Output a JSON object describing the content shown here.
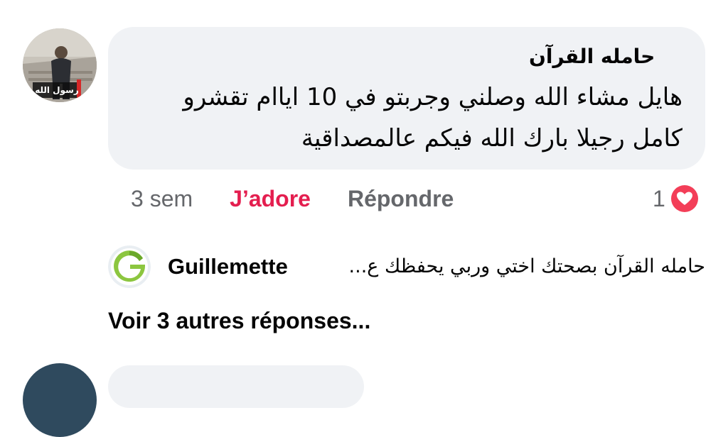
{
  "comment": {
    "author": "حامله القرآن",
    "text": "هايل مشاء الله وصلني وجربتو في 10 اياام تقشرو\nكامل رجيلا بارك الله فيكم عالمصداقية",
    "avatar_badge": "رسول الله"
  },
  "actions": {
    "time": "3 sem",
    "like_label": "J’adore",
    "reply_label": "Répondre"
  },
  "reactions": {
    "count": "1",
    "icon": "heart-icon",
    "color": "#f33e58"
  },
  "reply": {
    "author": "Guillemette",
    "text": "حامله القرآن بصحتك اختي وربي يحفظك ع...",
    "avatar_letter": "G",
    "avatar_color": "#8cc63f"
  },
  "more_replies": "Voir 3 autres réponses..."
}
